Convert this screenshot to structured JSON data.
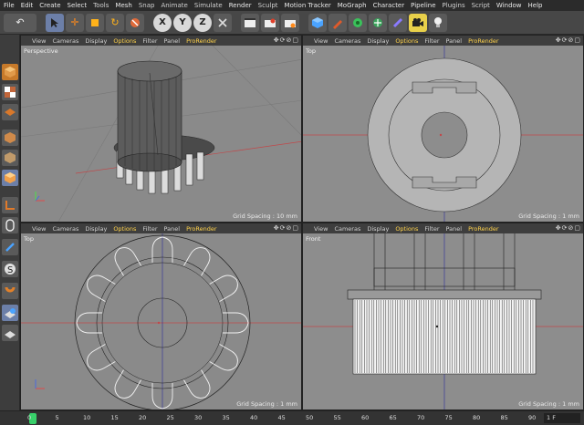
{
  "menu": [
    "File",
    "Edit",
    "Create",
    "Select",
    "Tools",
    "Mesh",
    "Snap",
    "Animate",
    "Simulate",
    "Render",
    "Sculpt",
    "Motion Tracker",
    "MoGraph",
    "Character",
    "Pipeline",
    "Plugins",
    "Script",
    "Window",
    "Help"
  ],
  "accent_color": "#ffd24a",
  "toolbar_icons": [
    "undo-icon",
    "select-arrow-icon",
    "move-icon",
    "scale-icon",
    "rotate-icon",
    "recent-icon",
    "x-axis-icon",
    "y-axis-icon",
    "z-axis-icon",
    "world-coord-icon",
    "render-view-icon",
    "render-picture-icon",
    "render-settings-icon",
    "cube-icon",
    "pen-icon",
    "subdivision-icon",
    "array-icon",
    "deformer-icon",
    "scene-camera-icon",
    "light-icon"
  ],
  "toolbar_glyphs": {
    "undo": "↶",
    "x": "X",
    "y": "Y",
    "z": "Z"
  },
  "viewport_menu": [
    "View",
    "Cameras",
    "Display",
    "Options",
    "Filter",
    "Panel",
    "ProRender"
  ],
  "viewports": [
    {
      "label": "Perspective",
      "grid": "Grid Spacing : 10 mm"
    },
    {
      "label": "Top",
      "grid": "Grid Spacing : 1 mm"
    },
    {
      "label": "Top",
      "grid": "Grid Spacing : 1 mm"
    },
    {
      "label": "Front",
      "grid": "Grid Spacing : 1 mm"
    }
  ],
  "timeline": {
    "ticks": [
      "0",
      "5",
      "10",
      "15",
      "20",
      "25",
      "30",
      "35",
      "40",
      "45",
      "50",
      "55",
      "60",
      "65",
      "70",
      "75",
      "80",
      "85",
      "90"
    ],
    "current_frame": "1 F"
  }
}
